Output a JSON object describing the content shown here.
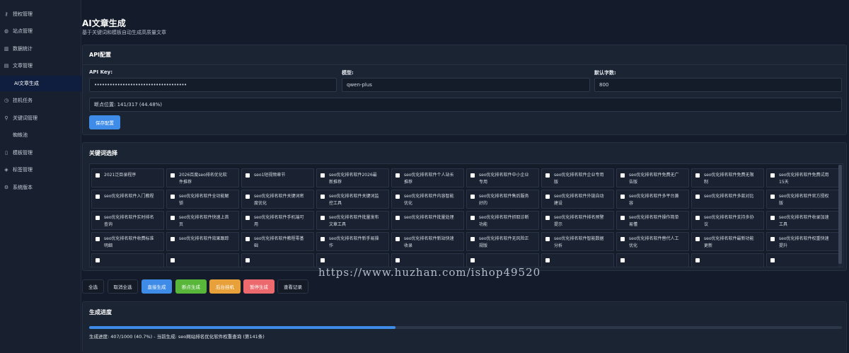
{
  "sidebar": {
    "items": [
      {
        "icon": "key-icon",
        "glyph": "⚷",
        "label": "授权管理"
      },
      {
        "icon": "globe-icon",
        "glyph": "◍",
        "label": "站点管理"
      },
      {
        "icon": "bar-chart-icon",
        "glyph": "▥",
        "label": "数据统计"
      },
      {
        "icon": "document-icon",
        "glyph": "▤",
        "label": "文章管理"
      },
      {
        "icon": "",
        "glyph": "",
        "label": "AI文章生成"
      },
      {
        "icon": "clock-icon",
        "glyph": "◷",
        "label": "挂机任务"
      },
      {
        "icon": "search-icon",
        "glyph": "⚲",
        "label": "关键词管理"
      },
      {
        "icon": "",
        "glyph": "",
        "label": "蜘蛛池"
      },
      {
        "icon": "file-icon",
        "glyph": "▯",
        "label": "模板管理"
      },
      {
        "icon": "tag-icon",
        "glyph": "◈",
        "label": "标签管理"
      },
      {
        "icon": "gear-icon",
        "glyph": "⚙",
        "label": "系统版本"
      }
    ]
  },
  "page": {
    "title": "AI文章生成",
    "subtitle": "基于关键词和模板自动生成高质量文章"
  },
  "api_config": {
    "header": "API配置",
    "api_key_label": "API Key:",
    "api_key_value": "••••••••••••••••••••••••••••••••••••",
    "model_label": "模型:",
    "model_value": "qwen-plus",
    "word_count_label": "默认字数:",
    "word_count_value": "800",
    "breakpoint_text": "断点位置: 141/317 (44.48%)",
    "save_button": "保存配置"
  },
  "keywords": {
    "header": "关键词选择",
    "items": [
      [
        "2021泛目录程序"
      ],
      [
        "2026百度seo排名优化软",
        "件推荐"
      ],
      [
        "seo1短视频章节"
      ],
      [
        "seo优化排名软件2026最",
        "新推荐"
      ],
      [
        "seo优化排名软件个人站长",
        "推荐"
      ],
      [
        "seo优化排名软件中小企业",
        "专用"
      ],
      [
        "seo优化排名软件企业专用",
        "版"
      ],
      [
        "seo优化排名软件免费无广",
        "告版"
      ],
      [
        "seo优化排名软件免费无限",
        "制"
      ],
      [
        "seo优化排名软件免费试用",
        "15天"
      ],
      [
        "seo优化排名软件入门教程"
      ],
      [
        "seo优化排名软件全功能解",
        "锁"
      ],
      [
        "seo优化排名软件关键词密",
        "度优化"
      ],
      [
        "seo优化排名软件关键词监",
        "控工具"
      ],
      [
        "seo优化排名软件内容智能",
        "优化"
      ],
      [
        "seo优化排名软件售后服务",
        "好的"
      ],
      [
        "seo优化排名软件外链自动",
        "建设"
      ],
      [
        "seo优化排名软件多平台兼",
        "容"
      ],
      [
        "seo优化排名软件多款对比"
      ],
      [
        "seo优化排名软件官方授权",
        "版"
      ],
      [
        "seo优化排名软件实时排名",
        "查询"
      ],
      [
        "seo优化排名软件快速上首",
        "页"
      ],
      [
        "seo优化排名软件手机端可",
        "用"
      ],
      [
        "seo优化排名软件批量发布",
        "文章工具"
      ],
      [
        "seo优化排名软件批量处理"
      ],
      [
        "seo优化排名软件抓取诊断",
        "功能"
      ],
      [
        "seo优化排名软件排名预警",
        "提示"
      ],
      [
        "seo优化排名软件操作简单",
        "易懂"
      ],
      [
        "seo优化排名软件支持多协",
        "议"
      ],
      [
        "seo优化排名软件收录加速",
        "工具"
      ],
      [
        "seo优化排名软件收费标准",
        "明细"
      ],
      [
        "seo优化排名软件效果跟踪"
      ],
      [
        "seo优化排名软件教程零基",
        "础"
      ],
      [
        "seo优化排名软件新手易操",
        "作"
      ],
      [
        "seo优化排名软件新站快速",
        "收录"
      ],
      [
        "seo优化排名软件无风险正",
        "规版"
      ],
      [
        "seo优化排名软件智能数据",
        "分析"
      ],
      [
        "seo优化排名软件替代人工",
        "优化"
      ],
      [
        "seo优化排名软件最新功能",
        "更新"
      ],
      [
        "seo优化排名软件权重快速",
        "提升"
      ],
      [
        ""
      ],
      [
        ""
      ],
      [
        ""
      ],
      [
        ""
      ],
      [
        ""
      ],
      [
        ""
      ],
      [
        ""
      ],
      [
        ""
      ],
      [
        ""
      ],
      [
        ""
      ]
    ]
  },
  "actions": {
    "select_all": "全选",
    "deselect_all": "取消全选",
    "direct_generate": "直接生成",
    "breakpoint_generate": "断点生成",
    "background_run": "后台挂机",
    "pause_generate": "暂停生成",
    "view_records": "查看记录"
  },
  "progress": {
    "header": "生成进度",
    "fraction": 0.407,
    "status_text": "生成进度: 407/1000 (40.7%) - 当前生成: seo网站排名优化软件权重查询 (第141条)"
  },
  "watermark": "https://www.huzhan.com/ishop49520",
  "colors": {
    "accent": "#3f8ce8",
    "green": "#58b63a",
    "orange": "#e8a03a",
    "red": "#ec6a6d",
    "background": "#141c2b"
  }
}
